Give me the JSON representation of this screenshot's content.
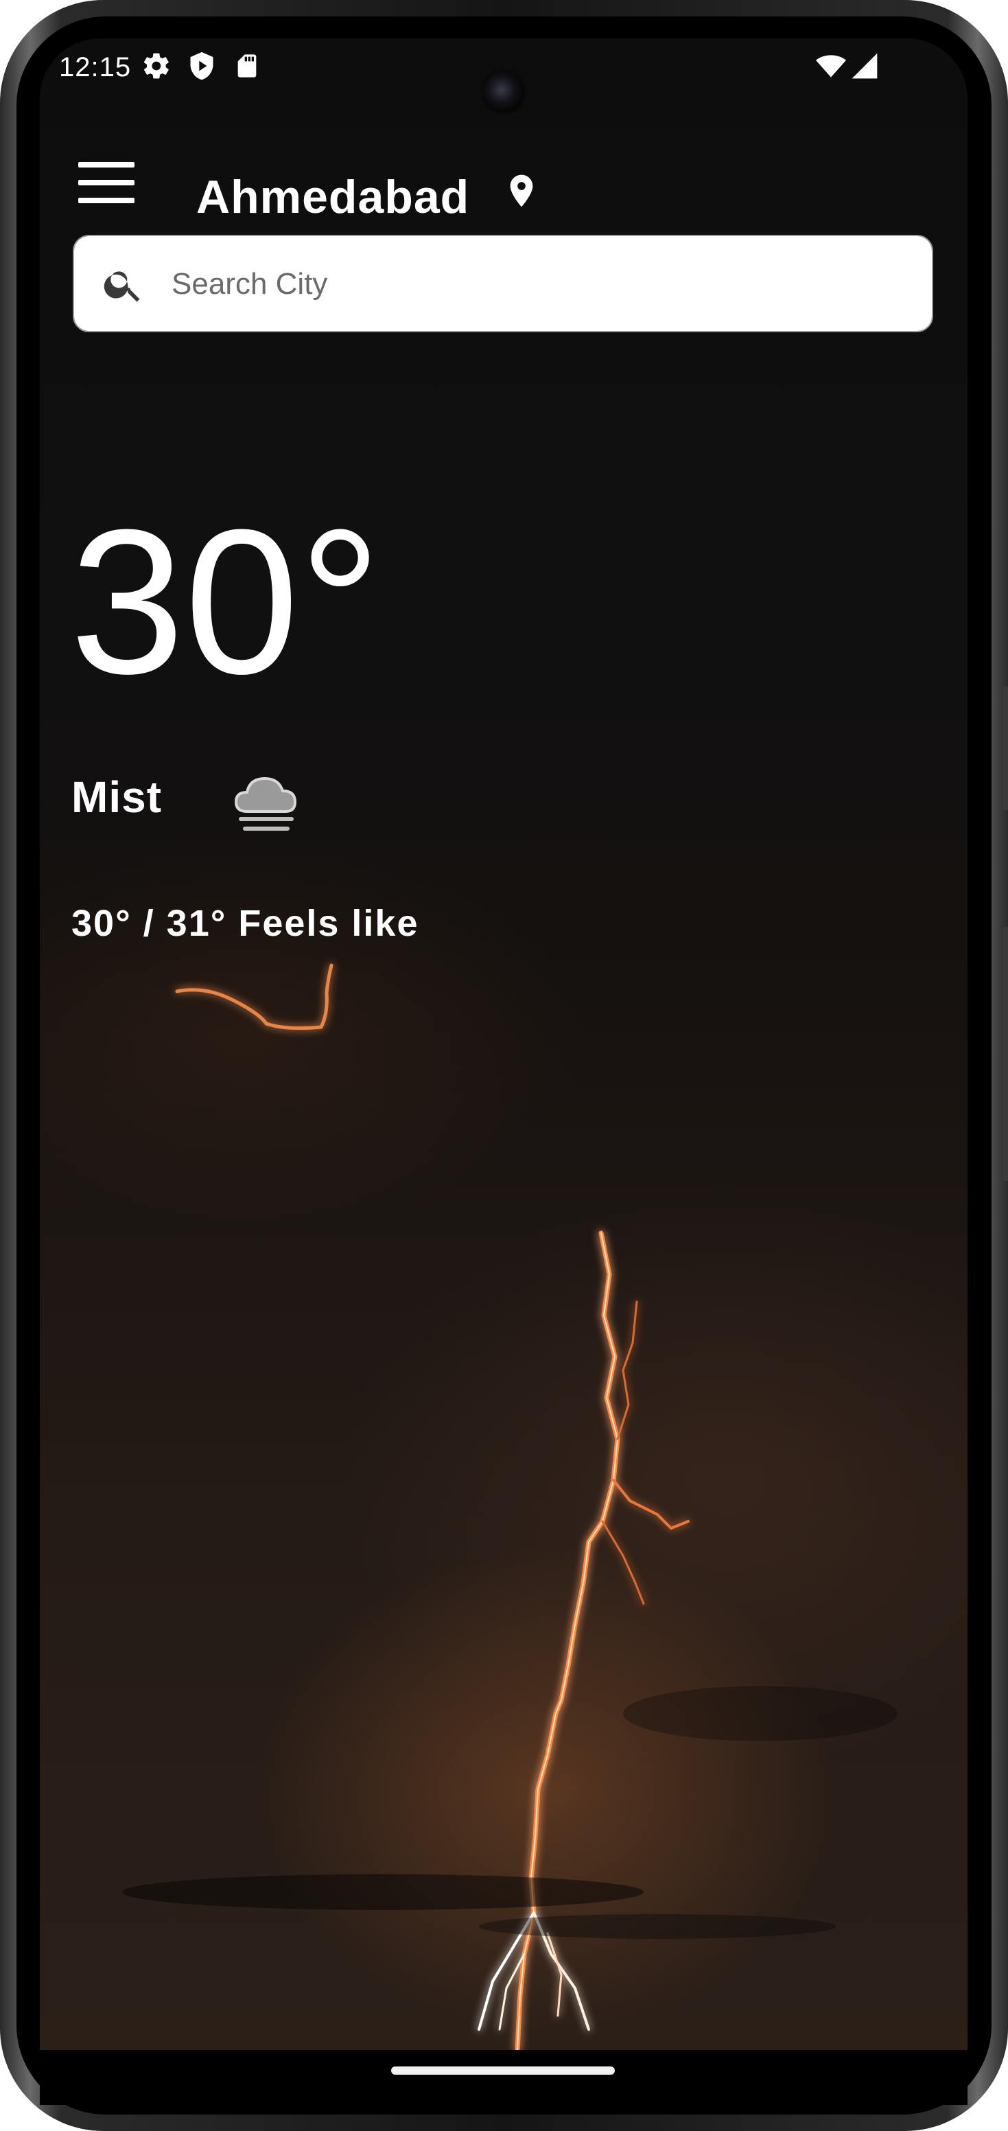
{
  "status_bar": {
    "time": "12:15",
    "icons": [
      "gear-icon",
      "shield-play-icon",
      "sd-card-icon",
      "wifi-icon",
      "signal-icon"
    ]
  },
  "app_bar": {
    "menu_icon": "menu-icon",
    "city": "Ahmedabad",
    "location_icon": "location-pin-icon"
  },
  "search": {
    "placeholder": "Search City",
    "value": "",
    "icon": "search-icon"
  },
  "weather": {
    "temperature": "30°",
    "condition": "Mist",
    "condition_icon": "cloud-mist-icon",
    "min_max_feels": "30° / 31° Feels like"
  },
  "colors": {
    "text": "#ffffff",
    "background": "#0c0c0c",
    "search_bg": "#ffffff",
    "placeholder": "#6b6b6b",
    "lightning": "#ff7a2e"
  }
}
